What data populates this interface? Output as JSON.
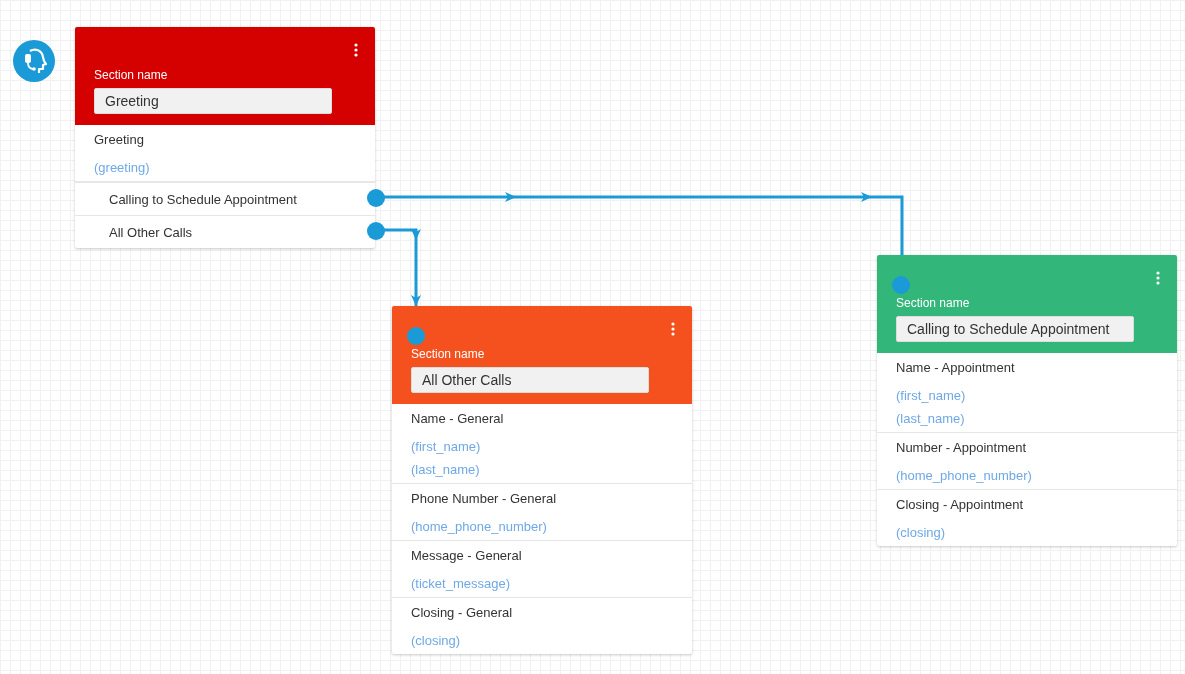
{
  "sections": [
    {
      "color": "#d50000",
      "input_port": false,
      "name_label": "Section name",
      "name_value": "Greeting",
      "groups": [
        {
          "title": "Greeting",
          "variables": [
            "(greeting)"
          ]
        }
      ],
      "branches": [
        {
          "label": "Calling to Schedule Appointment"
        },
        {
          "label": "All Other Calls"
        }
      ]
    },
    {
      "color": "#f4511e",
      "input_port": true,
      "name_label": "Section name",
      "name_value": "All Other Calls",
      "groups": [
        {
          "title": "Name - General",
          "variables": [
            "(first_name)",
            "(last_name)"
          ]
        },
        {
          "title": "Phone Number - General",
          "variables": [
            "(home_phone_number)"
          ]
        },
        {
          "title": "Message - General",
          "variables": [
            "(ticket_message)"
          ]
        },
        {
          "title": "Closing - General",
          "variables": [
            "(closing)"
          ]
        }
      ]
    },
    {
      "color": "#33b679",
      "input_port": true,
      "name_label": "Section name",
      "name_value": "Calling to Schedule Appointment",
      "groups": [
        {
          "title": "Name - Appointment",
          "variables": [
            "(first_name)",
            "(last_name)"
          ]
        },
        {
          "title": "Number - Appointment",
          "variables": [
            "(home_phone_number)"
          ]
        },
        {
          "title": "Closing - Appointment",
          "variables": [
            "(closing)"
          ]
        }
      ]
    }
  ]
}
